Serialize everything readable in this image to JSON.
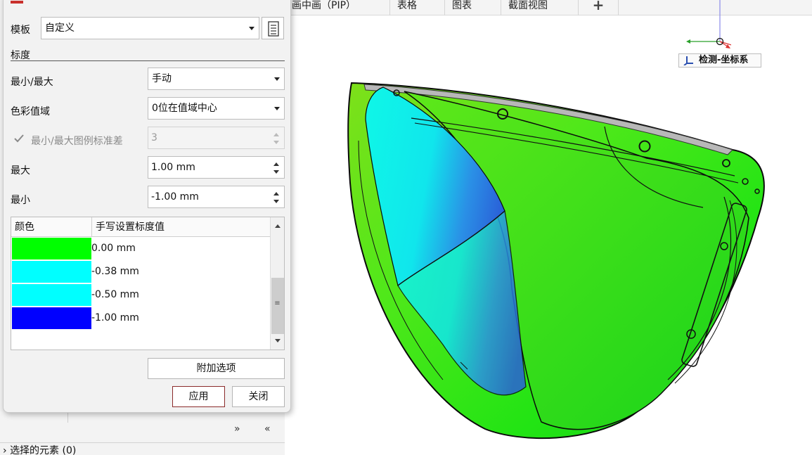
{
  "viewport_tabs": [
    "画中画（PIP）",
    "表格",
    "图表",
    "截面视图",
    "+"
  ],
  "coordinate_system": {
    "label": "检测-坐标系"
  },
  "dialog": {
    "template": {
      "label": "模板",
      "value": "自定义"
    },
    "section": {
      "title": "标度"
    },
    "minmax": {
      "label": "最小/最大",
      "value": "手动"
    },
    "color_range": {
      "label": "色彩值域",
      "value": "0位在值域中心"
    },
    "std_dev": {
      "label": "最小/最大图例标准差",
      "value": "3",
      "checked": true,
      "enabled": false
    },
    "max": {
      "label": "最大",
      "value": "1.00 mm"
    },
    "min": {
      "label": "最小",
      "value": "-1.00 mm"
    },
    "table": {
      "headers": [
        "颜色",
        "手写设置标度值"
      ],
      "rows": [
        {
          "color": "#00ff00",
          "value": "0.00 mm"
        },
        {
          "color": "#00ffff",
          "value": "-0.38 mm"
        },
        {
          "color": "#00ffff",
          "value": "-0.50 mm"
        },
        {
          "color": "#0000ff",
          "value": "-1.00 mm"
        }
      ]
    },
    "extra_options_label": "附加选项",
    "apply_label": "应用",
    "close_label": "关闭"
  },
  "background_panel": {
    "selected_elements": "选择的元素 (0)"
  }
}
